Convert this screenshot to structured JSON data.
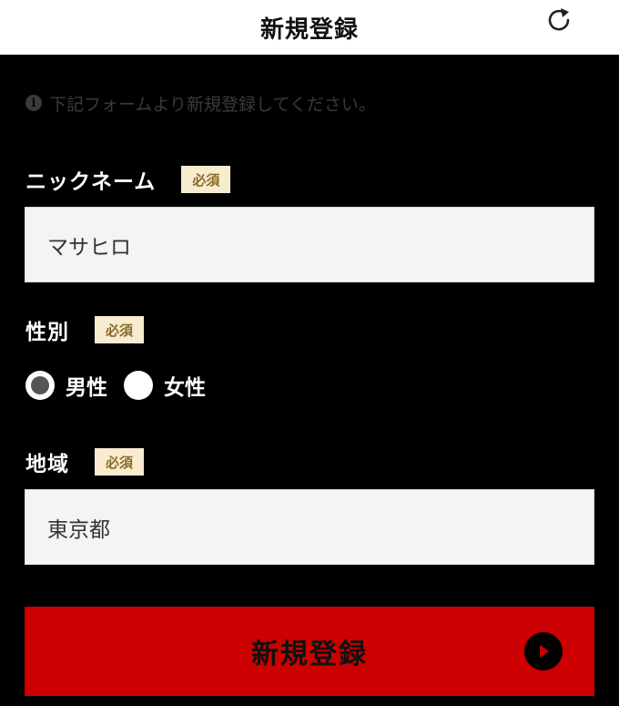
{
  "header": {
    "title": "新規登録",
    "refresh_icon": "refresh-icon"
  },
  "notice": {
    "icon": "info-icon",
    "icon_glyph": "i",
    "text": "下記フォームより新規登録してください。"
  },
  "form": {
    "nickname": {
      "label": "ニックネーム",
      "badge": "必須",
      "value": "マサヒロ"
    },
    "gender": {
      "label": "性別",
      "badge": "必須",
      "options": [
        {
          "label": "男性",
          "checked": true
        },
        {
          "label": "女性",
          "checked": false
        }
      ]
    },
    "region": {
      "label": "地域",
      "badge": "必須",
      "value": "東京都"
    }
  },
  "submit": {
    "label": "新規登録",
    "icon": "play-circle-icon"
  },
  "colors": {
    "background": "#000000",
    "header_bg": "#ffffff",
    "badge_bg": "#f7eccf",
    "badge_text": "#8a6a2a",
    "submit_bg": "#cc0000"
  }
}
